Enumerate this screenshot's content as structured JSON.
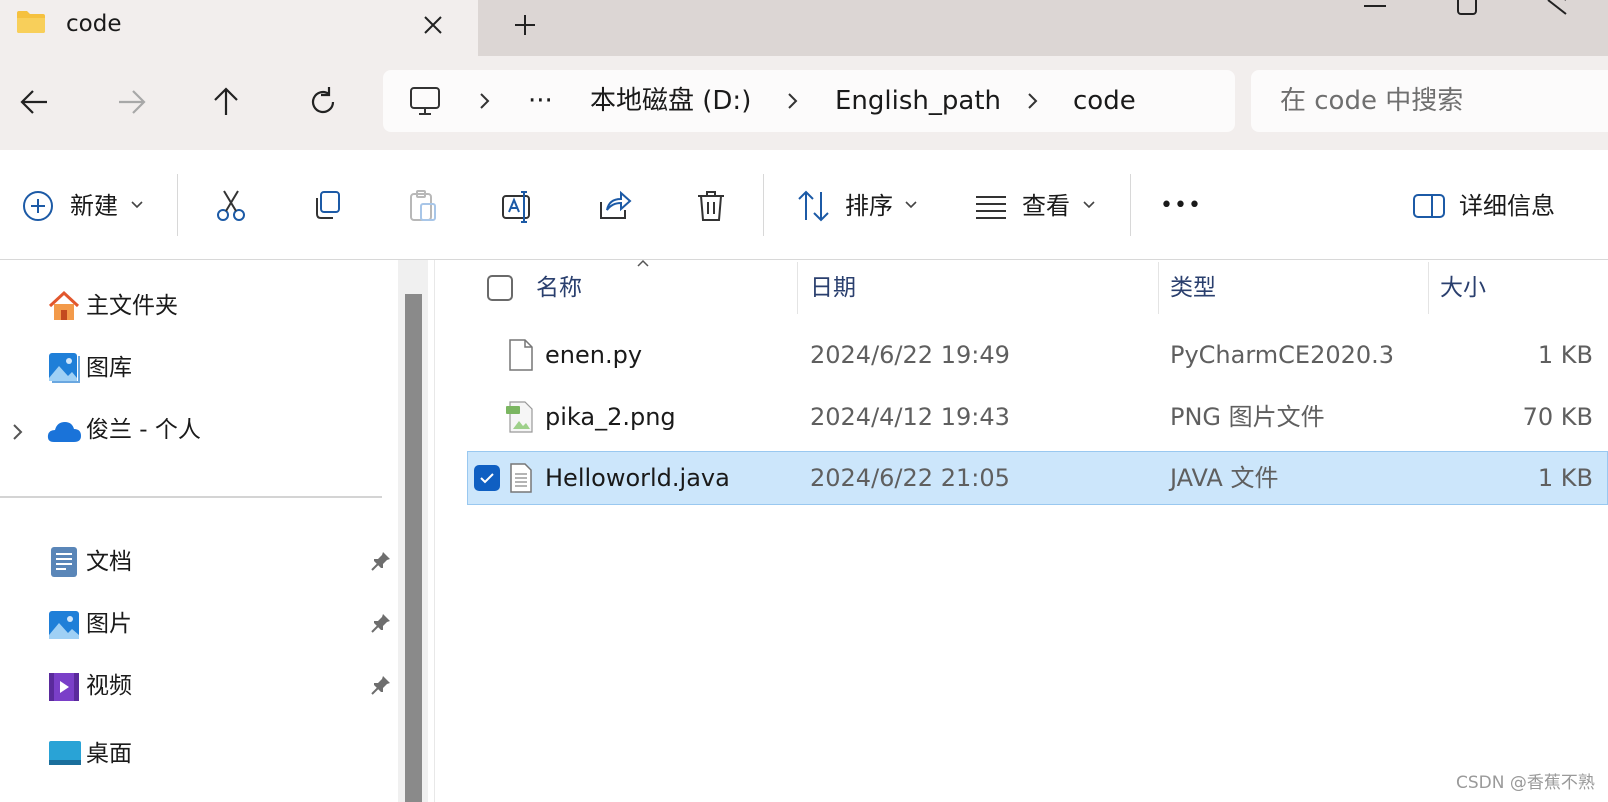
{
  "tab": {
    "title": "code",
    "close_icon": "close-icon",
    "newtab_icon": "plus-icon"
  },
  "breadcrumb": {
    "items": [
      "本地磁盘 (D:)",
      "English_path",
      "code"
    ],
    "overflow": "···"
  },
  "search": {
    "placeholder": "在 code 中搜索"
  },
  "toolbar": {
    "new_label": "新建",
    "sort_label": "排序",
    "view_label": "查看",
    "more_label": "•••",
    "details_label": "详细信息"
  },
  "sidebar": {
    "items": [
      {
        "label": "主文件夹",
        "icon": "home-icon"
      },
      {
        "label": "图库",
        "icon": "gallery-icon"
      },
      {
        "label": "俊兰 - 个人",
        "icon": "onedrive-icon"
      }
    ],
    "quick": [
      {
        "label": "文档",
        "icon": "documents-icon",
        "pinned": true
      },
      {
        "label": "图片",
        "icon": "pictures-icon",
        "pinned": true
      },
      {
        "label": "视频",
        "icon": "videos-icon",
        "pinned": true
      },
      {
        "label": "桌面",
        "icon": "desktop-icon",
        "pinned": false
      }
    ]
  },
  "columns": {
    "name": "名称",
    "date": "日期",
    "type": "类型",
    "size": "大小"
  },
  "files": [
    {
      "name": "enen.py",
      "date": "2024/6/22 19:49",
      "type": "PyCharmCE2020.3",
      "size": "1 KB",
      "icon": "file-icon",
      "selected": false
    },
    {
      "name": "pika_2.png",
      "date": "2024/4/12 19:43",
      "type": "PNG 图片文件",
      "size": "70 KB",
      "icon": "png-file-icon",
      "selected": false
    },
    {
      "name": "Helloworld.java",
      "date": "2024/6/22 21:05",
      "type": "JAVA 文件",
      "size": "1 KB",
      "icon": "text-file-icon",
      "selected": true
    }
  ],
  "watermark": "CSDN @香蕉不熟",
  "colors": {
    "accent": "#0067c0",
    "selection": "#cce6fb",
    "folder": "#f5c13f"
  }
}
